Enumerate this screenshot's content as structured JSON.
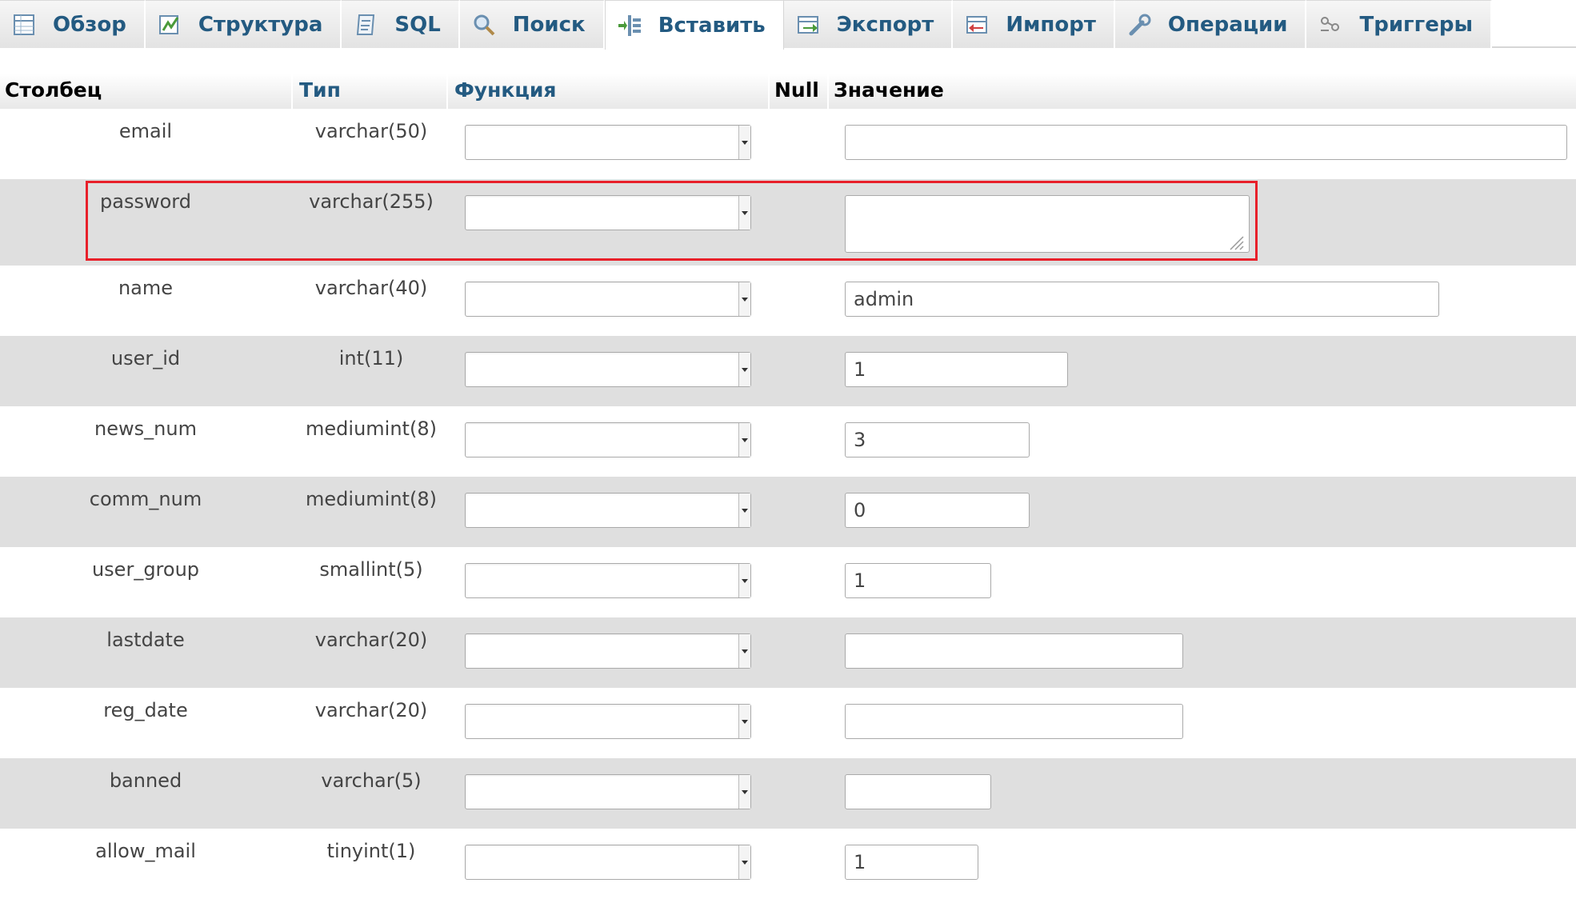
{
  "tabs": [
    {
      "label": "Обзор",
      "icon": "browse-icon"
    },
    {
      "label": "Структура",
      "icon": "structure-icon"
    },
    {
      "label": "SQL",
      "icon": "sql-icon"
    },
    {
      "label": "Поиск",
      "icon": "search-icon"
    },
    {
      "label": "Вставить",
      "icon": "insert-icon",
      "active": true
    },
    {
      "label": "Экспорт",
      "icon": "export-icon"
    },
    {
      "label": "Импорт",
      "icon": "import-icon"
    },
    {
      "label": "Операции",
      "icon": "operations-icon"
    },
    {
      "label": "Триггеры",
      "icon": "triggers-icon"
    }
  ],
  "header": {
    "column": "Столбец",
    "type": "Тип",
    "function": "Функция",
    "null": "Null",
    "value": "Значение"
  },
  "rows": [
    {
      "column": "email",
      "type": "varchar(50)",
      "value": ""
    },
    {
      "column": "password",
      "type": "varchar(255)",
      "value": ""
    },
    {
      "column": "name",
      "type": "varchar(40)",
      "value": "admin"
    },
    {
      "column": "user_id",
      "type": "int(11)",
      "value": "1"
    },
    {
      "column": "news_num",
      "type": "mediumint(8)",
      "value": "3"
    },
    {
      "column": "comm_num",
      "type": "mediumint(8)",
      "value": "0"
    },
    {
      "column": "user_group",
      "type": "smallint(5)",
      "value": "1"
    },
    {
      "column": "lastdate",
      "type": "varchar(20)",
      "value": ""
    },
    {
      "column": "reg_date",
      "type": "varchar(20)",
      "value": ""
    },
    {
      "column": "banned",
      "type": "varchar(5)",
      "value": ""
    },
    {
      "column": "allow_mail",
      "type": "tinyint(1)",
      "value": "1"
    }
  ],
  "colors": {
    "tab_text": "#235a81",
    "row_alt": "#dfdfdf",
    "highlight": "#e8202a"
  }
}
